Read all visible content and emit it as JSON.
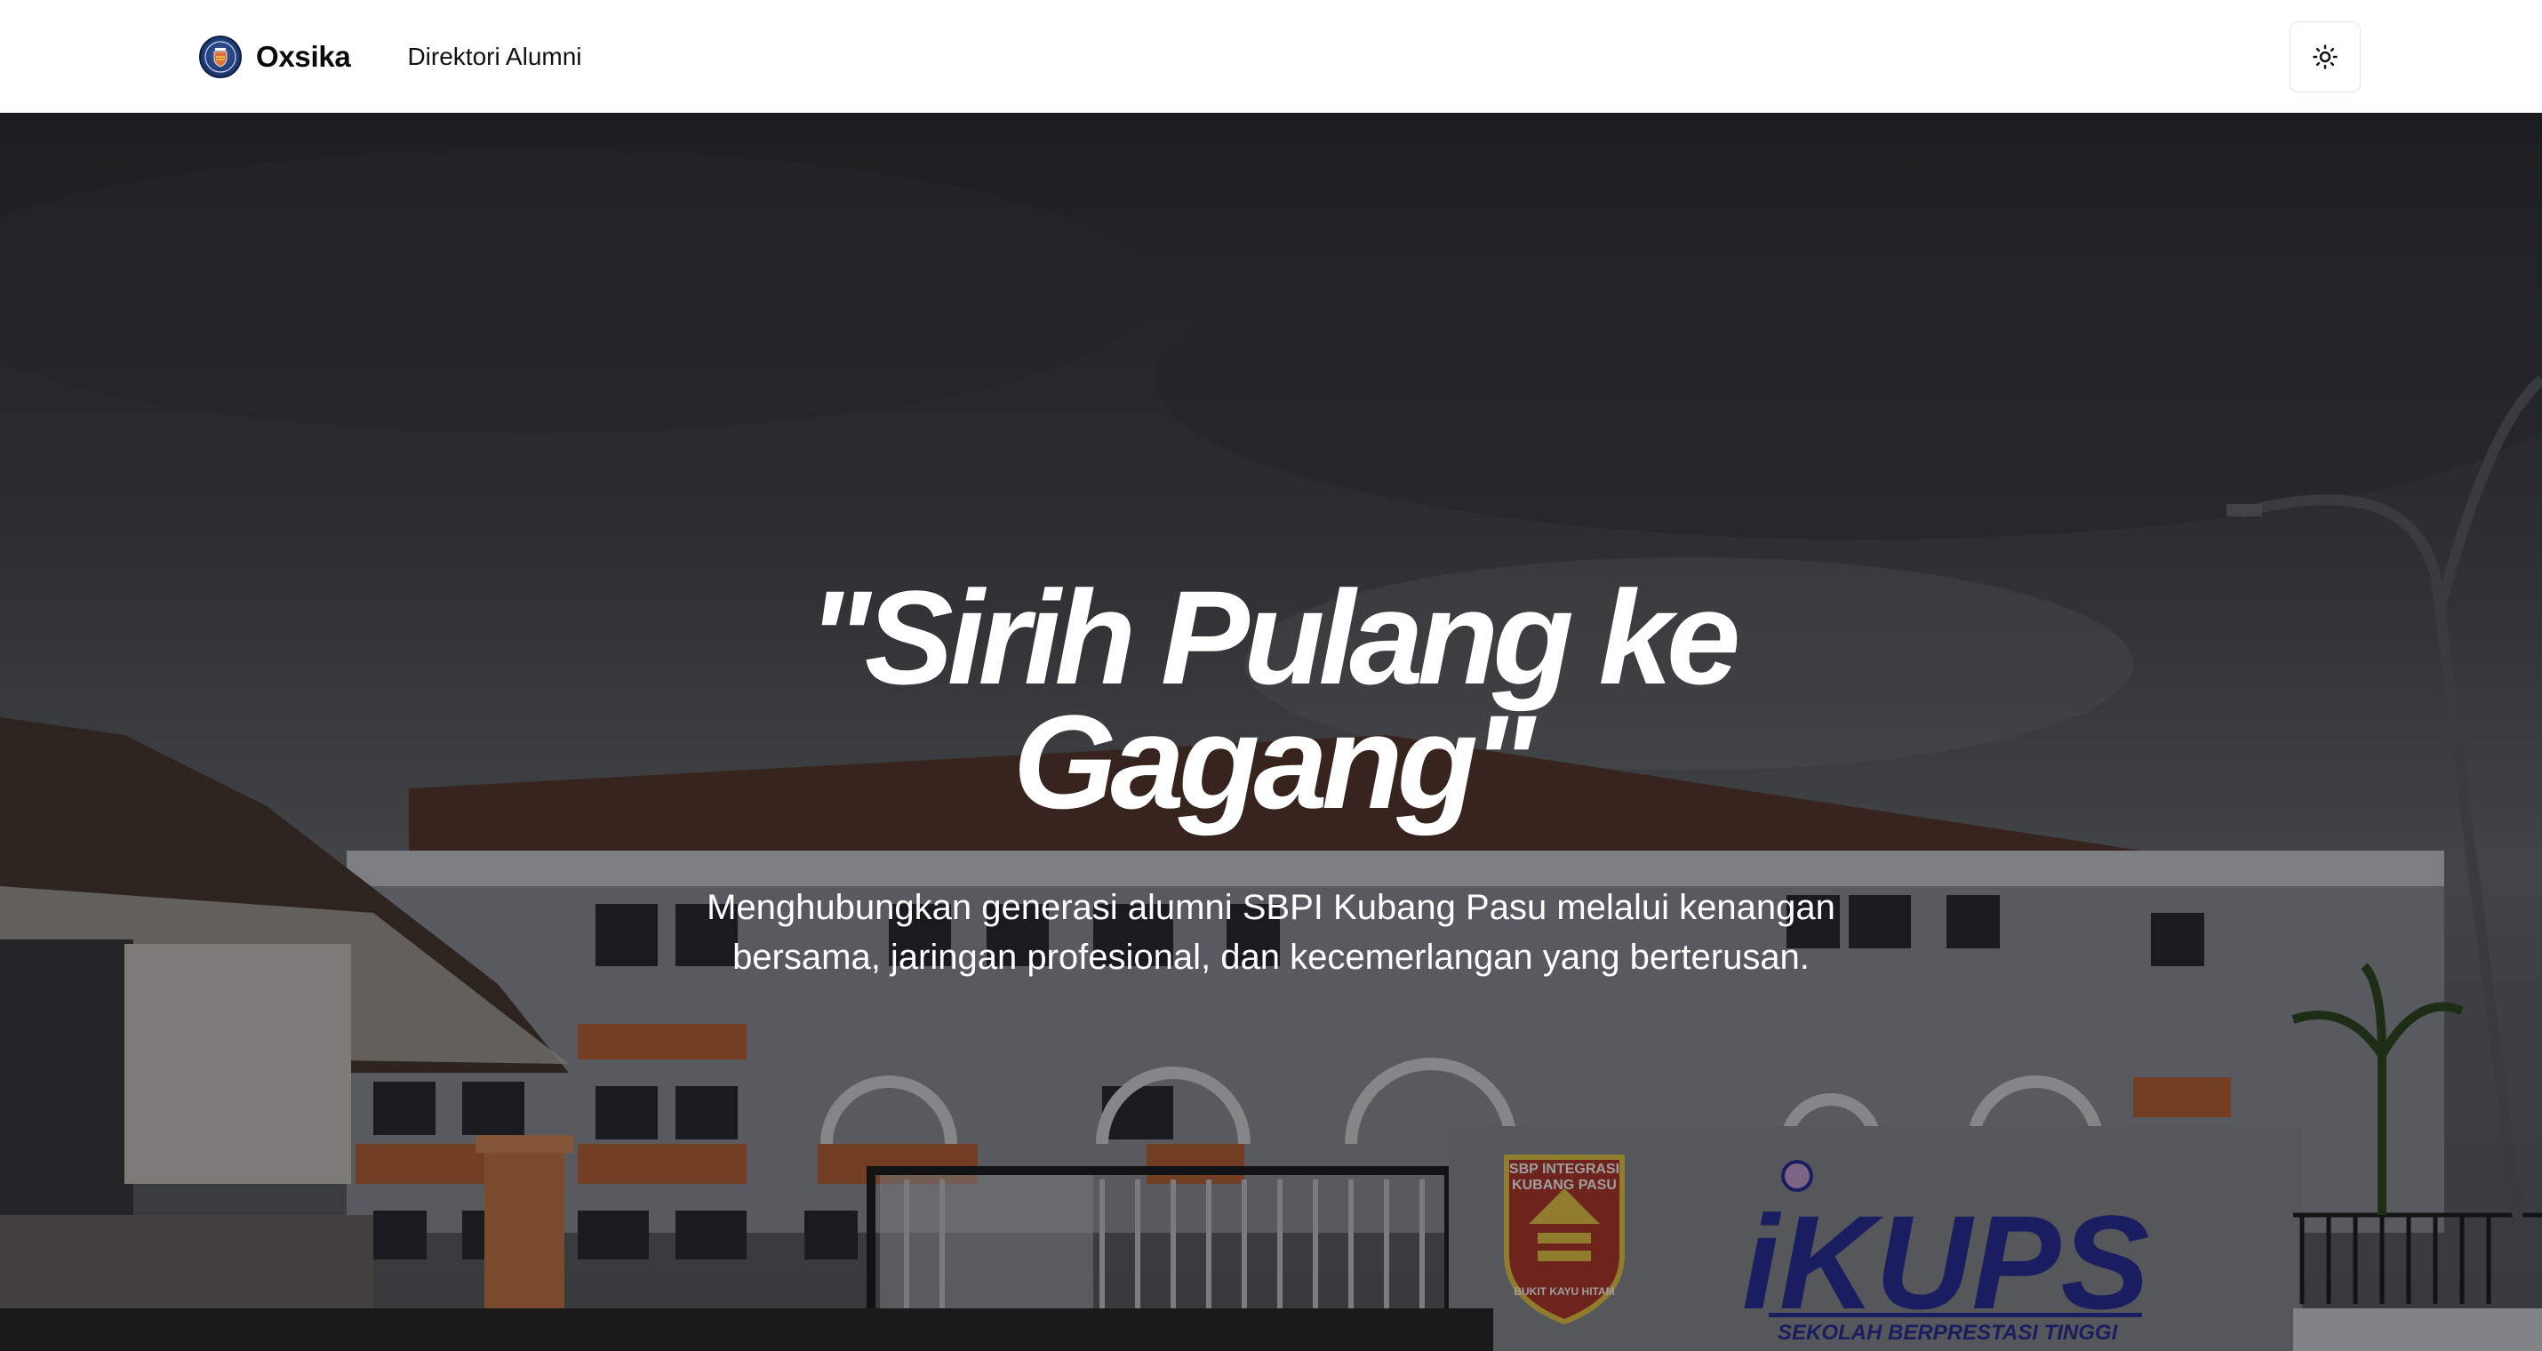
{
  "navbar": {
    "brand_name": "Oxsika",
    "logo_icon": "school-crest-logo",
    "links": [
      {
        "label": "Direktori Alumni"
      }
    ],
    "theme_toggle_icon": "sun-icon"
  },
  "hero": {
    "title": "\"Sirih Pulang ke Gagang\"",
    "subtitle": "Menghubungkan generasi alumni SBPI Kubang Pasu melalui kenangan bersama, jaringan profesional, dan kecemerlangan yang berterusan.",
    "background": {
      "crest_text_1": "SBP INTEGRASI",
      "crest_text_2": "KUBANG PASU",
      "crest_motto": "BUKIT KAYU HITAM",
      "sign_text": "iKUPS",
      "sign_subtext": "SEKOLAH BERPRESTASI TINGGI"
    }
  },
  "colors": {
    "navbar_bg": "#ffffff",
    "brand_text": "#0a0a0a",
    "hero_text": "#ffffff",
    "sign_blue": "#2a2f9c",
    "accent_orange": "#d9733a"
  }
}
